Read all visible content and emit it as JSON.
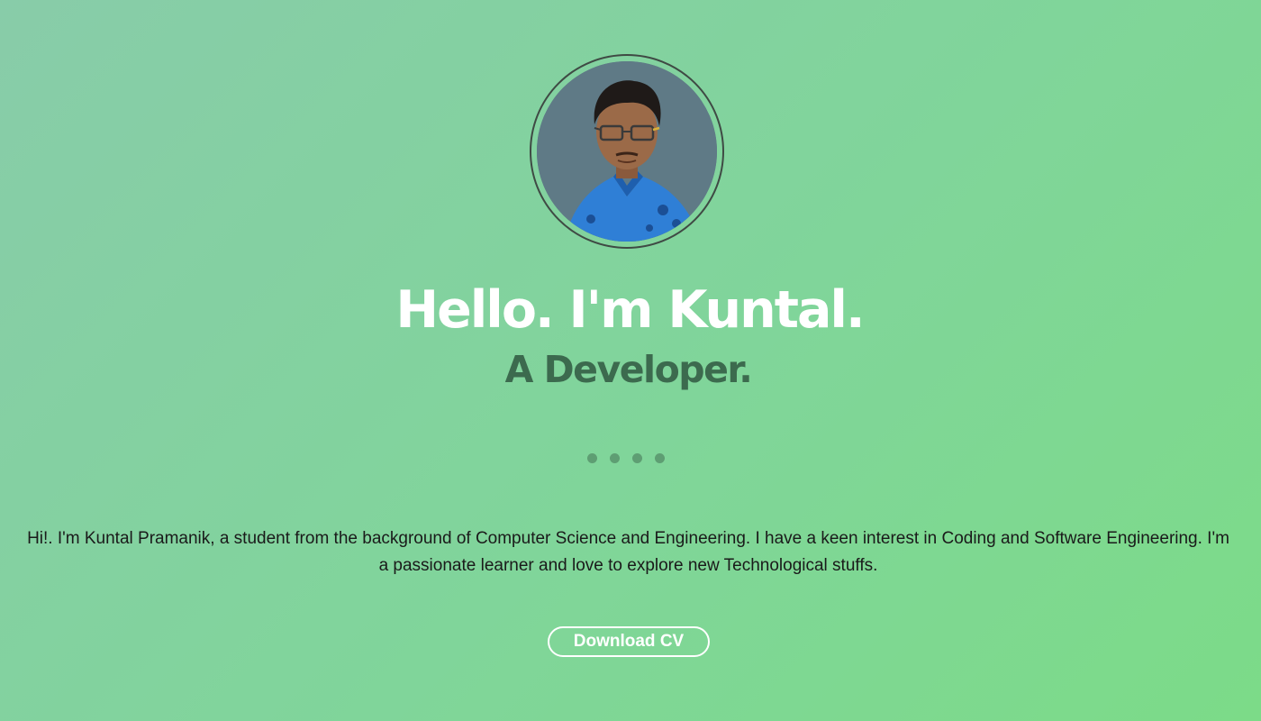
{
  "hero": {
    "greeting": "Hello. I'm Kuntal.",
    "role": "A Developer.",
    "bio": "Hi!. I'm Kuntal Pramanik, a student from the background of Computer Science and Engineering. I have a keen interest in Coding and Software Engineering. I'm a passionate learner and love to explore new Technological stuffs.",
    "cta_label": "Download CV"
  },
  "colors": {
    "background_start": "#88cca9",
    "background_end": "#7cdb88",
    "title": "#ffffff",
    "subtitle": "#3c6a4e",
    "dots": "#5e9e73",
    "ring": "#3f4a44"
  },
  "icons": {
    "avatar": "profile-photo",
    "separator": "four-dot-separator"
  }
}
